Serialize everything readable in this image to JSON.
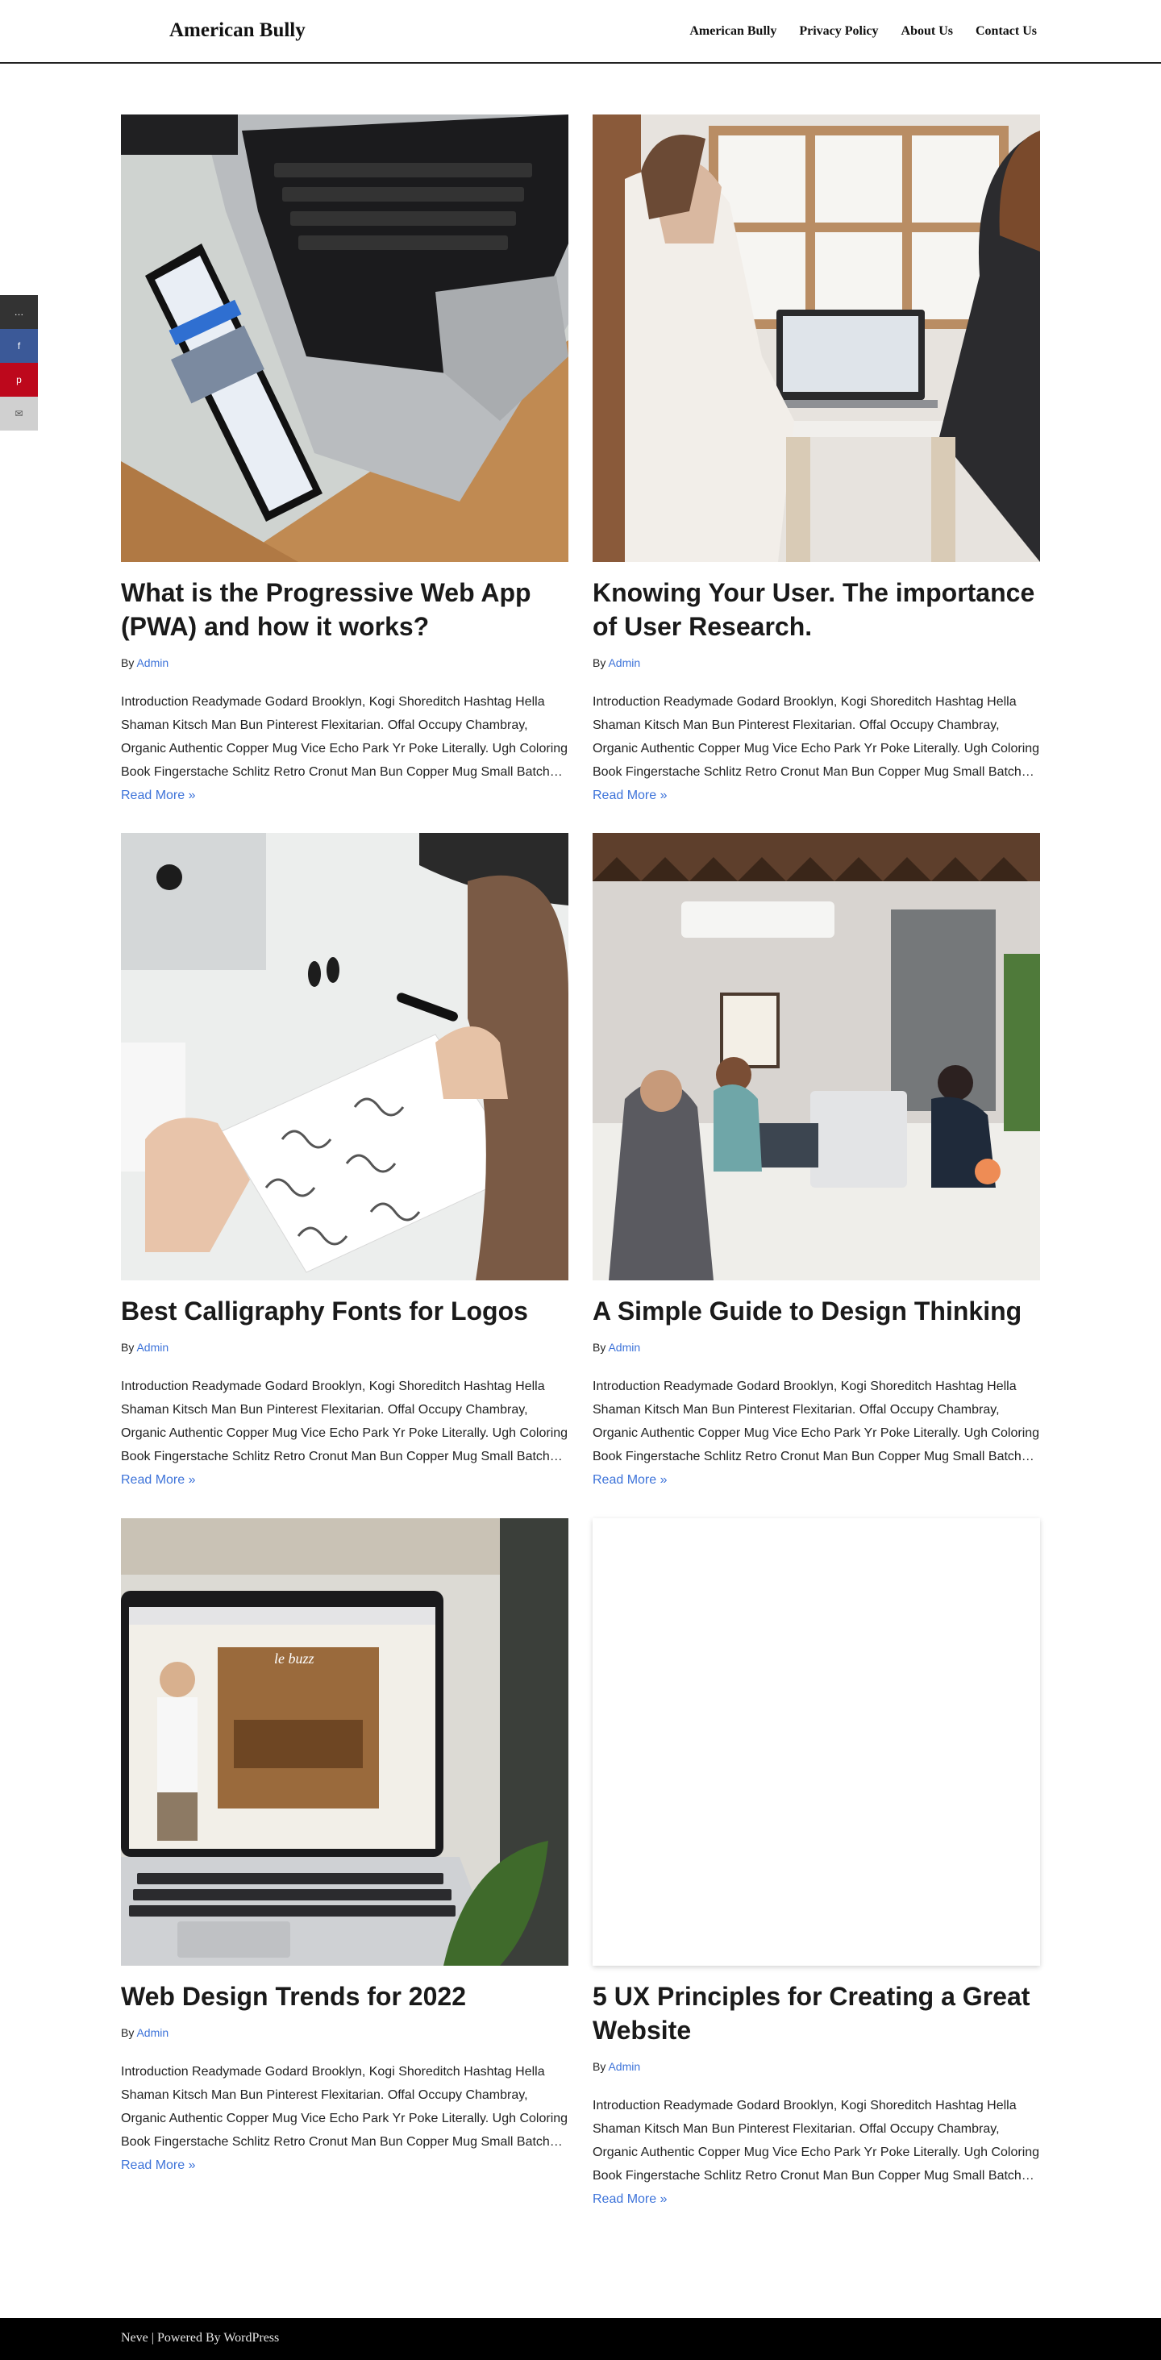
{
  "site": {
    "title": "American Bully"
  },
  "nav": [
    "American Bully",
    "Privacy Policy",
    "About Us",
    "Contact Us"
  ],
  "share": {
    "more": "…",
    "facebook": "f",
    "pinterest": "p",
    "email": "✉"
  },
  "posts": [
    {
      "title": "What is the Progressive Web App (PWA) and how it works?",
      "by": "By",
      "author": "Admin",
      "excerpt": "Introduction Readymade Godard Brooklyn, Kogi Shoreditch Hashtag Hella Shaman Kitsch Man Bun Pinterest Flexitarian. Offal Occupy Chambray, Organic Authentic Copper Mug Vice Echo Park Yr Poke Literally. Ugh Coloring Book Fingerstache Schlitz Retro Cronut Man Bun Copper Mug Small Batch…",
      "read_more": "Read More »"
    },
    {
      "title": "Knowing Your User. The importance of User Research.",
      "by": "By",
      "author": "Admin",
      "excerpt": "Introduction Readymade Godard Brooklyn, Kogi Shoreditch Hashtag Hella Shaman Kitsch Man Bun Pinterest Flexitarian. Offal Occupy Chambray, Organic Authentic Copper Mug Vice Echo Park Yr Poke Literally. Ugh Coloring Book Fingerstache Schlitz Retro Cronut Man Bun Copper Mug Small Batch…",
      "read_more": "Read More »"
    },
    {
      "title": "Best Calligraphy Fonts for Logos",
      "by": "By",
      "author": "Admin",
      "excerpt": "Introduction Readymade Godard Brooklyn, Kogi Shoreditch Hashtag Hella Shaman Kitsch Man Bun Pinterest Flexitarian. Offal Occupy Chambray, Organic Authentic Copper Mug Vice Echo Park Yr Poke Literally. Ugh Coloring Book Fingerstache Schlitz Retro Cronut Man Bun Copper Mug Small Batch…",
      "read_more": "Read More »"
    },
    {
      "title": "A Simple Guide to Design Thinking",
      "by": "By",
      "author": "Admin",
      "excerpt": "Introduction Readymade Godard Brooklyn, Kogi Shoreditch Hashtag Hella Shaman Kitsch Man Bun Pinterest Flexitarian. Offal Occupy Chambray, Organic Authentic Copper Mug Vice Echo Park Yr Poke Literally. Ugh Coloring Book Fingerstache Schlitz Retro Cronut Man Bun Copper Mug Small Batch…",
      "read_more": "Read More »"
    },
    {
      "title": "Web Design Trends for 2022",
      "by": "By",
      "author": "Admin",
      "excerpt": "Introduction Readymade Godard Brooklyn, Kogi Shoreditch Hashtag Hella Shaman Kitsch Man Bun Pinterest Flexitarian. Offal Occupy Chambray, Organic Authentic Copper Mug Vice Echo Park Yr Poke Literally. Ugh Coloring Book Fingerstache Schlitz Retro Cronut Man Bun Copper Mug Small Batch…",
      "read_more": "Read More »"
    },
    {
      "title": "5 UX Principles for Creating a Great Website",
      "by": "By",
      "author": "Admin",
      "excerpt": "Introduction Readymade Godard Brooklyn, Kogi Shoreditch Hashtag Hella Shaman Kitsch Man Bun Pinterest Flexitarian. Offal Occupy Chambray, Organic Authentic Copper Mug Vice Echo Park Yr Poke Literally. Ugh Coloring Book Fingerstache Schlitz Retro Cronut Man Bun Copper Mug Small Batch…",
      "read_more": "Read More »"
    }
  ],
  "thumb_pictures": [
    "laptop-and-phone-with-facebook",
    "women-at-laptop-by-window",
    "hand-writing-calligraphy",
    "people-working-in-office",
    "laptop-showing-website",
    ""
  ],
  "footer": {
    "text": "Neve | Powered By WordPress"
  },
  "colors": {
    "link": "#3d73d9",
    "footer_bg": "#000000",
    "facebook": "#3b5998",
    "pinterest": "#bd081c"
  }
}
